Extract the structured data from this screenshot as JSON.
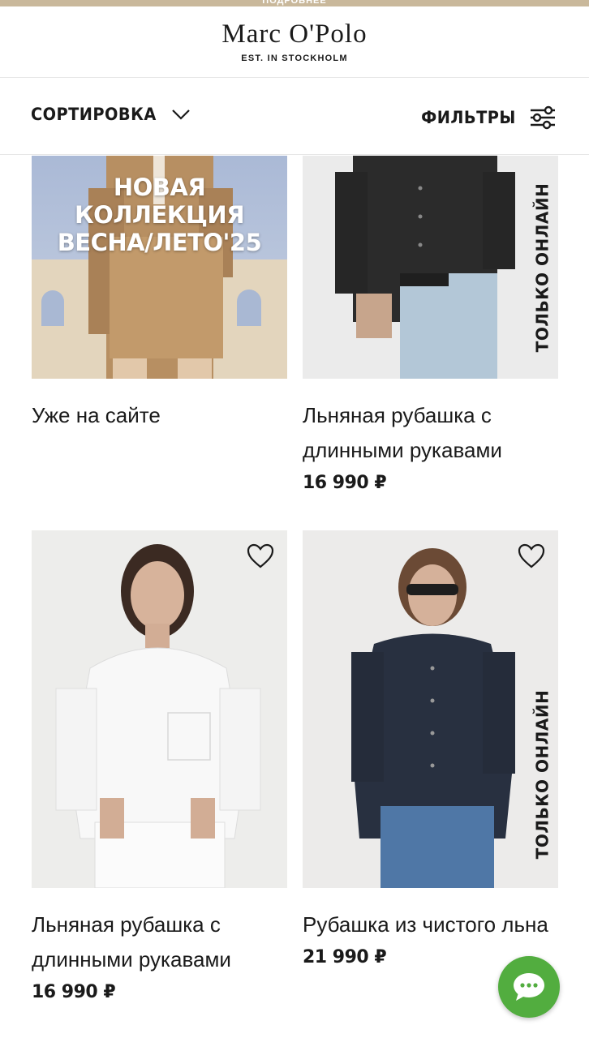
{
  "promo_strip": {
    "text": "ПОДРОБНЕЕ"
  },
  "header": {
    "brand": "Marc O'Polo",
    "tagline": "EST. IN STOCKHOLM"
  },
  "toolbar": {
    "sort_label": "СОРТИРОВКА",
    "filter_label": "ФИЛЬТРЫ"
  },
  "products": [
    {
      "title": "Уже на сайте",
      "promo_text_line1": "НОВАЯ КОЛЛЕКЦИЯ",
      "promo_text_line2": "ВЕСНА/ЛЕТО'25"
    },
    {
      "title": "Льняная рубашка с длинными рукавами",
      "price": "16 990 ₽",
      "badge": "ТОЛЬКО ОНЛАЙН"
    },
    {
      "title": "Льняная рубашка с длинными рукавами",
      "price": "16 990 ₽"
    },
    {
      "title": "Рубашка из чистого льна",
      "price": "21 990 ₽",
      "badge": "ТОЛЬКО ОНЛАЙН"
    }
  ],
  "icons": {
    "sort": "chevron-down-icon",
    "filter": "sliders-icon",
    "wishlist": "heart-icon",
    "chat": "chat-bubble-icon"
  },
  "colors": {
    "chat_fab": "#52ad3f",
    "promo_strip": "#c9b89b",
    "text": "#1a1a1a"
  }
}
